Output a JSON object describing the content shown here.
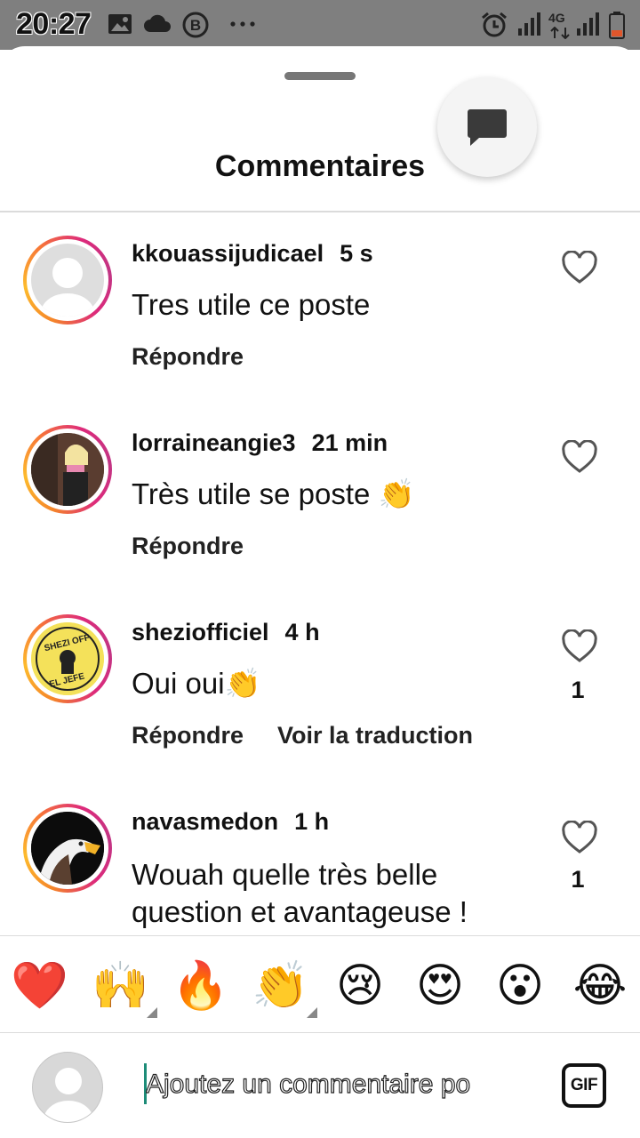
{
  "status_bar": {
    "time": "20:27",
    "network": "4G",
    "icons": [
      "image-icon",
      "cloud-icon",
      "b-circle-icon",
      "more-dots-icon",
      "alarm-icon",
      "signal-icon",
      "signal-icon",
      "battery-icon"
    ]
  },
  "header": {
    "title": "Commentaires"
  },
  "comments": [
    {
      "username": "kkouassijudicael",
      "time": "5 s",
      "text": "Tres utile ce poste",
      "reply": "Répondre",
      "likes": ""
    },
    {
      "username": "lorraineangie3",
      "time": "21 min",
      "text": "Très utile se poste 👏",
      "reply": "Répondre",
      "likes": ""
    },
    {
      "username": "sheziofficiel",
      "time": "4 h",
      "text": "Oui oui👏",
      "reply": "Répondre",
      "translate": "Voir la traduction",
      "likes": "1",
      "avatar_text": [
        "SHEZI OFF",
        "EL JEFE"
      ]
    },
    {
      "username": "navasmedon",
      "time": "1 h",
      "text": "Wouah quelle très belle",
      "text2": "question et avantageuse !",
      "likes": "1"
    }
  ],
  "emoji_bar": [
    "❤️",
    "🙌",
    "🔥",
    "👏",
    "😢",
    "😍",
    "😮",
    "😂"
  ],
  "input": {
    "placeholder": "Ajoutez un commentaire po",
    "gif_label": "GIF"
  }
}
